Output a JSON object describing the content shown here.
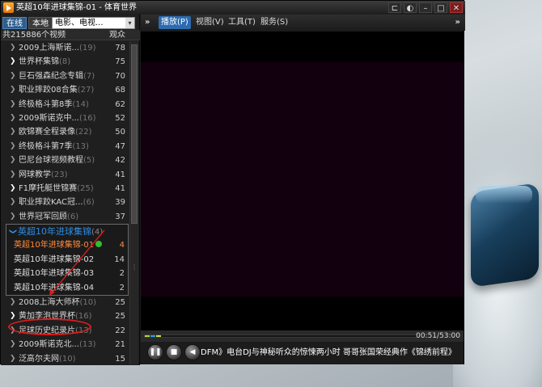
{
  "window": {
    "title": "英超10年进球集锦-01 - 体育世界",
    "buttons": {
      "pip": "⊏",
      "skin": "◐",
      "minimize": "–",
      "maximize": "□",
      "close": "✕"
    }
  },
  "left_panel": {
    "tab_online": "在线",
    "tab_local": "本地",
    "search_value": "电影、电视...",
    "search_button_icon": "▾",
    "total_label": "共215886个视频",
    "views_header": "观众",
    "items_top": [
      {
        "name": "2009上海斯诺...",
        "count": "(19)",
        "views": "78",
        "bright": false
      },
      {
        "name": "世界杯集锦",
        "count": "(8)",
        "views": "75",
        "bright": true
      },
      {
        "name": "巨石强森纪念专辑",
        "count": "(7)",
        "views": "70",
        "bright": false
      },
      {
        "name": "职业摔跤08合集",
        "count": "(27)",
        "views": "68",
        "bright": false
      },
      {
        "name": "终极格斗第8季",
        "count": "(14)",
        "views": "62",
        "bright": false
      },
      {
        "name": "2009斯诺克中...",
        "count": "(16)",
        "views": "52",
        "bright": false
      },
      {
        "name": "欧锦赛全程录像",
        "count": "(22)",
        "views": "50",
        "bright": false
      },
      {
        "name": "终极格斗第7季",
        "count": "(13)",
        "views": "47",
        "bright": false
      },
      {
        "name": "巴尼台球视频教程",
        "count": "(5)",
        "views": "42",
        "bright": false
      },
      {
        "name": "网球教学",
        "count": "(23)",
        "views": "41",
        "bright": false
      },
      {
        "name": "F1摩托艇世锦赛",
        "count": "(25)",
        "views": "41",
        "bright": true
      },
      {
        "name": "职业摔跤KAC冠...",
        "count": "(6)",
        "views": "39",
        "bright": false
      },
      {
        "name": "世界冠军回顾",
        "count": "(6)",
        "views": "37",
        "bright": false
      }
    ],
    "group": {
      "name": "英超10年进球集锦",
      "count": "(4)",
      "items": [
        {
          "name": "英超10年进球集锦-01",
          "views": "4",
          "playing": true
        },
        {
          "name": "英超10年进球集锦-02",
          "views": "14",
          "playing": false
        },
        {
          "name": "英超10年进球集锦-03",
          "views": "2",
          "playing": false
        },
        {
          "name": "英超10年进球集锦-04",
          "views": "2",
          "playing": false
        }
      ]
    },
    "items_bottom": [
      {
        "name": "2008上海大师杯",
        "count": "(10)",
        "views": "25",
        "bright": false
      },
      {
        "name": "黄加李泡世界杯",
        "count": "(16)",
        "views": "25",
        "bright": true
      },
      {
        "name": "足球历史纪录片",
        "count": "(13)",
        "views": "22",
        "bright": false
      },
      {
        "name": "2009斯诺克北...",
        "count": "(13)",
        "views": "21",
        "bright": false
      },
      {
        "name": "泛高尔夫网",
        "count": "(10)",
        "views": "15",
        "bright": false
      }
    ]
  },
  "menubar": {
    "expand_left": "»",
    "expand_right": "»",
    "items": [
      {
        "label": "播放(P)",
        "active": true
      },
      {
        "label": "视图(V)",
        "active": false
      },
      {
        "label": "工具(T)",
        "active": false
      },
      {
        "label": "服务(S)",
        "active": false
      }
    ]
  },
  "player": {
    "time": "00:51/53:00",
    "progress_fraction": 0.016,
    "buffer_colors": [
      "#b5d336",
      "#2fa0d8",
      "#c9e04a"
    ],
    "controls": {
      "pause": "❚❚",
      "stop": "■",
      "mute": "◀"
    },
    "ticker": "DFM》电台DJ与神秘听众的惊悚两小时    哥哥张国荣经典作《锦绣前程》"
  },
  "colors": {
    "annotation": "#e01b1b",
    "active_tab": "#2f5d8c",
    "group_title": "#2f8ee6",
    "playing_item": "#ff8a3d"
  }
}
